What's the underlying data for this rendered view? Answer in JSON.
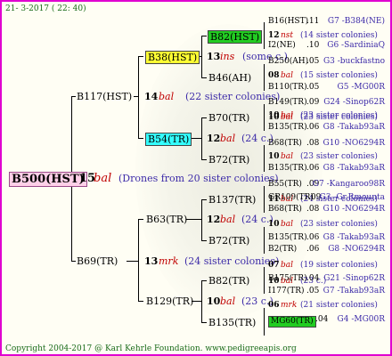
{
  "header": {
    "date": "21- 3-2017",
    "time": "( 22: 40)"
  },
  "footer": {
    "copyright": "Copyright 2004-2017 @ Karl Kehrle Foundation.",
    "url": "www.pedigreeapis.org"
  },
  "root": {
    "name": "B500(HST)",
    "gen": "15",
    "type": "bal",
    "note": "(Drones from 20 sister colonies)"
  },
  "g1": [
    {
      "name": "B117(HST)",
      "gen": "14",
      "type": "bal",
      "note": "(22 sister colonies)"
    },
    {
      "name": "B69(TR)",
      "gen": "13",
      "type": "mrk",
      "note": "(24 sister colonies)"
    }
  ],
  "g2": [
    {
      "name": "B38(HST)",
      "gen": "13",
      "type": "ins",
      "note": "(some c.)"
    },
    {
      "name": "B54(TR)",
      "gen": "12",
      "type": "bal",
      "note": "(24 c.)"
    },
    {
      "name": "B63(TR)",
      "gen": "12",
      "type": "bal",
      "note": "(24 c.)"
    },
    {
      "name": "B129(TR)",
      "gen": "10",
      "type": "bal",
      "note": "(23 c.)"
    }
  ],
  "g3": [
    {
      "name": "B82(HST)",
      "gen": "12",
      "type": "nst",
      "note": "(14 sister colonies)"
    },
    {
      "name": "B46(AH)"
    },
    {
      "name": "B70(TR)",
      "gen": "10",
      "type": "bal",
      "note": "(23 sister colonies)"
    },
    {
      "name": "B72(TR)"
    },
    {
      "name": "B137(TR)",
      "gen": "11",
      "type": "bal",
      "note": "(24 sister colonies)"
    },
    {
      "name": "B72(TR)"
    },
    {
      "name": "B82(TR)",
      "gen": "10",
      "type": "bal",
      "note": "(23 c.)"
    },
    {
      "name": "B135(TR)"
    }
  ],
  "g4": [
    {
      "name": "B16(HST)",
      "gen": ".11",
      "src": "G7 -B384(NE)"
    },
    {
      "name": "I2(NE)",
      "gen": ".10",
      "src": "G6 -SardiniaQ"
    },
    {
      "name": "B250(AH)",
      "gen": ".05",
      "src": "G3 -buckfastno"
    },
    {
      "name": "08",
      "type": "bal",
      "note": "(15 sister colonies)"
    },
    {
      "name": "B110(TR)",
      "gen": ".05",
      "src": "G5 -MG00R"
    },
    {
      "name": "B149(TR)",
      "gen": ".09",
      "src": "G24 -Sinop62R"
    },
    {
      "name": "10",
      "type": "bal",
      "note": "(23 sister colonies)"
    },
    {
      "name": "B135(TR)",
      "gen": ".06",
      "src": "G8 -Takab93aR"
    },
    {
      "name": "B68(TR)",
      "gen": ".08",
      "src": "G10 -NO6294R"
    },
    {
      "name": "10",
      "type": "bal",
      "note": "(23 sister colonies)"
    },
    {
      "name": "B135(TR)",
      "gen": ".06",
      "src": "G8 -Takab93aR"
    },
    {
      "name": "B55(TR)",
      "gen": ".09",
      "src": "G7 -Kangaroo98R"
    },
    {
      "name": "GR109(TR)",
      "gen": ".09",
      "src": "G3 -Gr.Rmounta"
    },
    {
      "name": "B68(TR)",
      "gen": ".08",
      "src": "G10 -NO6294R"
    },
    {
      "name": "10",
      "type": "bal",
      "note": "(23 sister colonies)"
    },
    {
      "name": "B135(TR)",
      "gen": ".06",
      "src": "G8 -Takab93aR"
    },
    {
      "name": "B2(TR)",
      "gen": ".06",
      "src": "G8 -NO6294R"
    },
    {
      "name": "07",
      "type": "bal",
      "note": "(19 sister colonies)"
    },
    {
      "name": "B175(TR)",
      "gen": ".04",
      "src": "G21 -Sinop62R"
    },
    {
      "name": "I177(TR)",
      "gen": ".05",
      "src": "G7 -Takab93aR"
    },
    {
      "name": "06",
      "type": "mrk",
      "note": "(21 sister colonies)"
    },
    {
      "name": "MG60(TR)",
      "gen": ".04",
      "src": "G4 -MG00R"
    }
  ],
  "colors": {
    "border": "#e000d0",
    "yellow": "#ffff33",
    "green": "#22cc22",
    "cyan": "#33ffff",
    "pink": "#ffd0e8",
    "blue": "#3c2aa8",
    "red": "#c00000"
  }
}
